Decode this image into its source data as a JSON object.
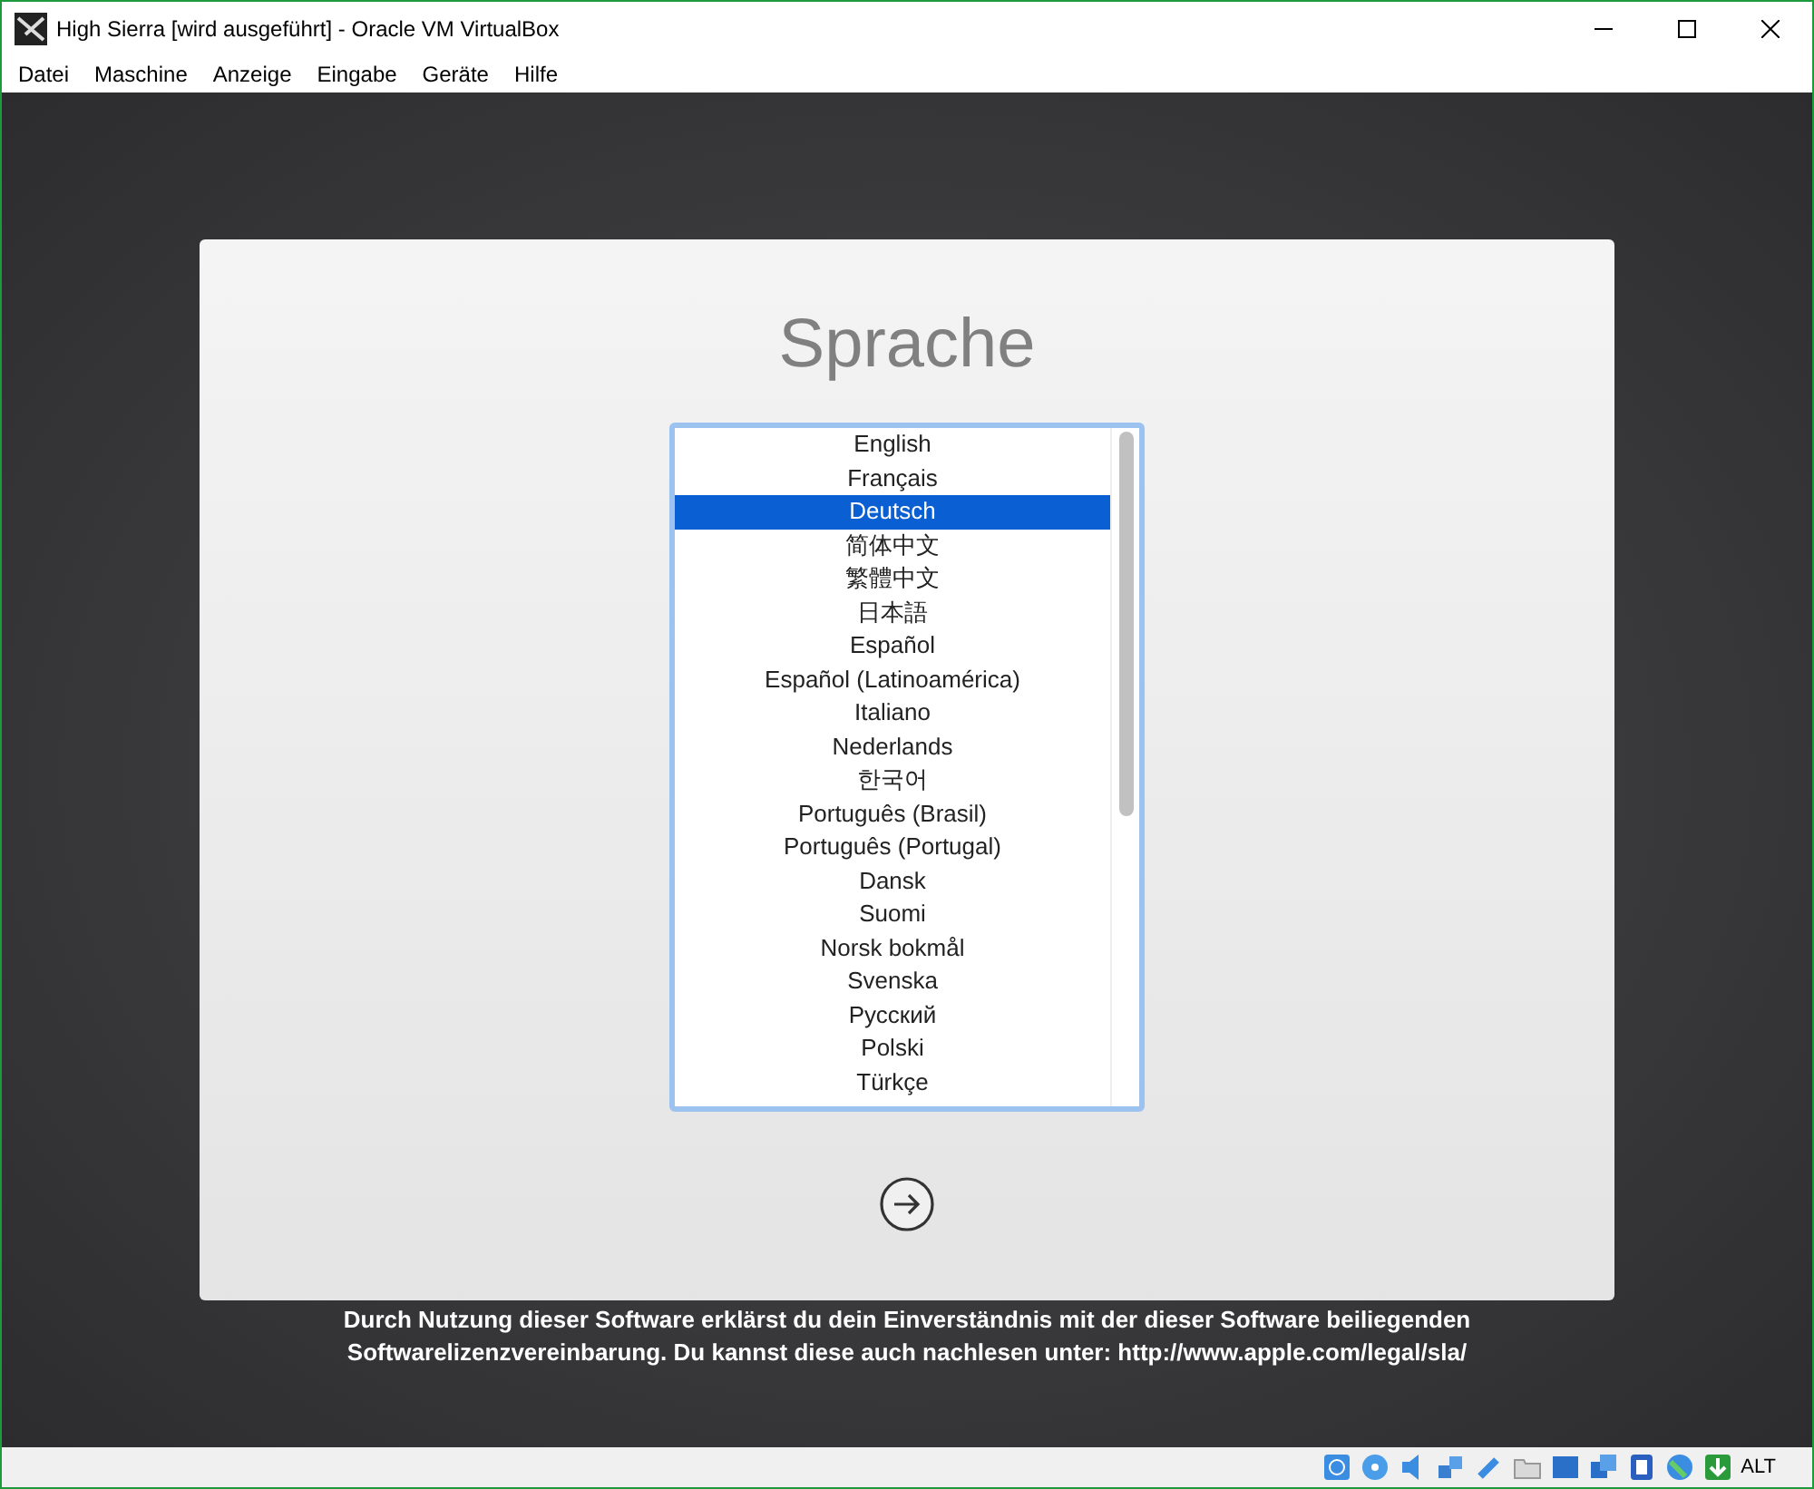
{
  "window": {
    "title": "High Sierra [wird ausgeführt] - Oracle VM VirtualBox"
  },
  "menu": [
    "Datei",
    "Maschine",
    "Anzeige",
    "Eingabe",
    "Geräte",
    "Hilfe"
  ],
  "installer": {
    "title": "Sprache",
    "languages": [
      {
        "label": "English",
        "selected": false
      },
      {
        "label": "Français",
        "selected": false
      },
      {
        "label": "Deutsch",
        "selected": true
      },
      {
        "label": "简体中文",
        "selected": false
      },
      {
        "label": "繁體中文",
        "selected": false
      },
      {
        "label": "日本語",
        "selected": false
      },
      {
        "label": "Español",
        "selected": false
      },
      {
        "label": "Español (Latinoamérica)",
        "selected": false
      },
      {
        "label": "Italiano",
        "selected": false
      },
      {
        "label": "Nederlands",
        "selected": false
      },
      {
        "label": "한국어",
        "selected": false
      },
      {
        "label": "Português (Brasil)",
        "selected": false
      },
      {
        "label": "Português (Portugal)",
        "selected": false
      },
      {
        "label": "Dansk",
        "selected": false
      },
      {
        "label": "Suomi",
        "selected": false
      },
      {
        "label": "Norsk bokmål",
        "selected": false
      },
      {
        "label": "Svenska",
        "selected": false
      },
      {
        "label": "Русский",
        "selected": false
      },
      {
        "label": "Polski",
        "selected": false
      },
      {
        "label": "Türkçe",
        "selected": false
      }
    ]
  },
  "license_notice": [
    "Durch Nutzung dieser Software erklärst du dein Einverständnis mit der dieser Software beiliegenden",
    "Softwarelizenzvereinbarung. Du kannst diese auch nachlesen unter: http://www.apple.com/legal/sla/"
  ],
  "status_bar": {
    "host_key": "ALT"
  }
}
